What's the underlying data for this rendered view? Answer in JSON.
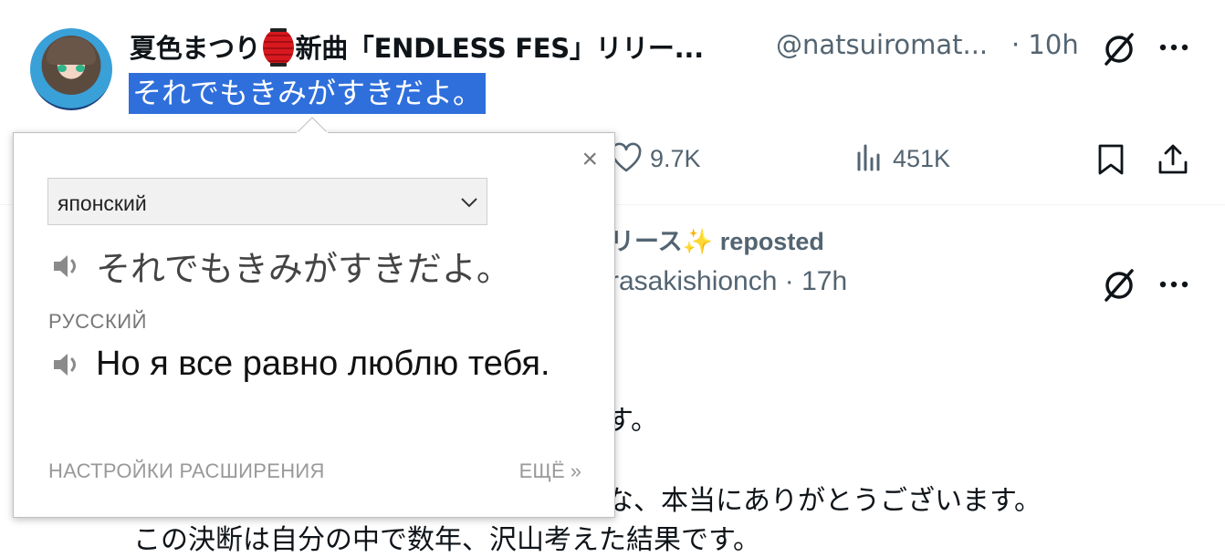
{
  "tweet": {
    "display_name_part1": "夏色まつり",
    "display_name_part2": "新曲「ENDLESS FES」リリー...",
    "handle": "@natsuiromat...",
    "time": "· 10h",
    "selected_text": "それでもきみがすきだよ。",
    "metrics": {
      "likes": "9.7K",
      "views": "451K"
    }
  },
  "tweet2": {
    "repost_prefix": "リース",
    "repost_suffix": "reposted",
    "handle_time": "rasakishionch · 17h",
    "line1": "す。",
    "line2": "な、本当にありがとうございます。",
    "line3": "この決断は自分の中で数年、沢山考えた結果です。"
  },
  "popup": {
    "close": "×",
    "source_lang": "японский",
    "source_text": "それでもきみがすきだよ。",
    "target_lang": "РУССКИЙ",
    "translation": "Но я все равно люблю тебя.",
    "settings_link": "НАСТРОЙКИ РАСШИРЕНИЯ",
    "more_link": "ЕЩЁ »"
  },
  "icons": {
    "grok": "grok-icon",
    "more": "more-icon",
    "like": "heart-icon",
    "views": "bar-chart-icon",
    "bookmark": "bookmark-icon",
    "share": "share-icon",
    "speaker": "speaker-icon",
    "dropdown": "chevron-down-icon",
    "sparkle": "sparkles-emoji",
    "lantern": "red-lantern-emoji"
  },
  "colors": {
    "selection": "#2f6fdb",
    "secondary_text": "#536471",
    "lantern_red": "#d8181f",
    "sparkle_yellow": "#f4b400"
  }
}
